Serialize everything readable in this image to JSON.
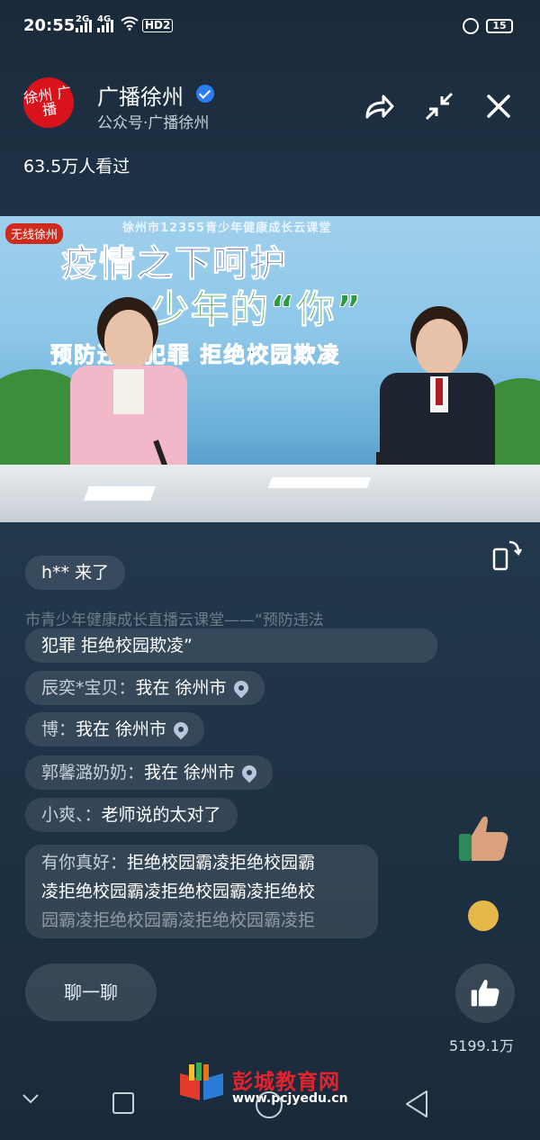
{
  "status_bar": {
    "time": "20:55",
    "signal1_label": "2G",
    "signal2_label": "4G",
    "hd_label": "HD2",
    "battery": "15"
  },
  "header": {
    "logo_text": "徐州 广播",
    "account_name": "广播徐州",
    "account_sub": "公众号·广播徐州",
    "view_count": "63.5万人看过"
  },
  "video": {
    "top_line": "徐州市12355青少年健康成长云课堂",
    "channel_logo": "无线徐州",
    "title_line1": "疫情之下呵护",
    "title_line2": "少年的“你”",
    "title_line3": "预防违法犯罪  拒绝校园欺凌"
  },
  "chat": {
    "entry_notice": "h** 来了",
    "faded_line": "市青少年健康成长直播云课堂——“预防违法",
    "continued_line": "犯罪 拒绝校园欺凌”",
    "messages": [
      {
        "name": "辰奕*宝贝：",
        "text": "我在 徐州市",
        "pin": true
      },
      {
        "name": "博：",
        "text": "我在 徐州市",
        "pin": true
      },
      {
        "name": "郭馨潞奶奶：",
        "text": "我在 徐州市",
        "pin": true
      },
      {
        "name": "小爽、：",
        "text": "老师说的太对了",
        "pin": false
      }
    ],
    "long_message": {
      "name": "有你真好：",
      "line1_text": "拒绝校园霸凌拒绝校园霸",
      "line2_text": "凌拒绝校园霸凌拒绝校园霸凌拒绝校",
      "line3_text": "园霸凌拒绝校园霸凌拒绝校园霸凌拒"
    },
    "input_placeholder": "聊一聊",
    "like_count": "5199.1万"
  },
  "watermark": {
    "title": "彭城教育网",
    "url": "www.pcjyedu.cn"
  },
  "icons": {
    "share": "share-icon",
    "minimize": "minimize-icon",
    "close": "close-icon",
    "rotate": "rotate-screen-icon",
    "like": "thumbs-up-icon"
  },
  "colors": {
    "logo_red": "#d8131c",
    "verified_blue": "#2c7df4",
    "watermark_red": "#e4232f"
  }
}
